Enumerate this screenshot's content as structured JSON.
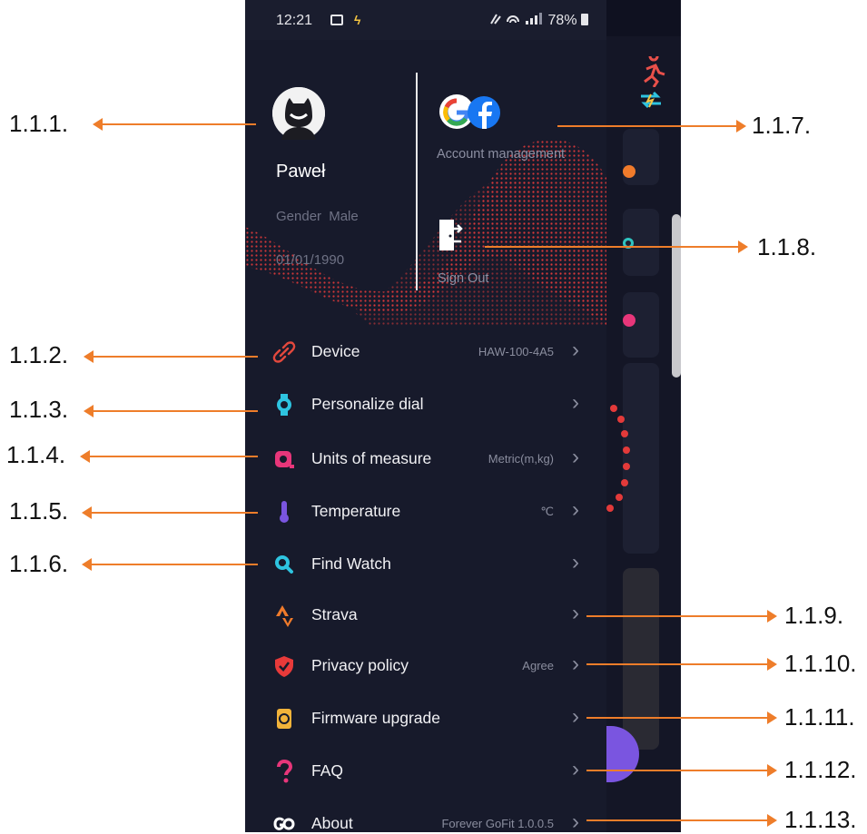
{
  "status_bar": {
    "time": "12:21",
    "battery": "78%"
  },
  "profile": {
    "name": "Paweł",
    "gender_label": "Gender",
    "gender_value": "Male",
    "birth_date": "01/01/1990"
  },
  "account": {
    "management_label": "Account management",
    "sign_out_label": "Sign Out"
  },
  "menu": [
    {
      "label": "Device",
      "value": "HAW-100-4A5",
      "icon": "link-icon",
      "color": "#e2483d"
    },
    {
      "label": "Personalize dial",
      "value": "",
      "icon": "watch-icon",
      "color": "#2ec4e0"
    },
    {
      "label": "Units of measure",
      "value": "Metric(m,kg)",
      "icon": "units-icon",
      "color": "#e8367a"
    },
    {
      "label": "Temperature",
      "value": "℃",
      "icon": "thermometer-icon",
      "color": "#7a55e0"
    },
    {
      "label": "Find Watch",
      "value": "",
      "icon": "search-icon",
      "color": "#2ec4e0"
    },
    {
      "label": "Strava",
      "value": "",
      "icon": "strava-icon",
      "color": "#f07b2b"
    },
    {
      "label": "Privacy policy",
      "value": "Agree",
      "icon": "shield-icon",
      "color": "#e83a3a"
    },
    {
      "label": "Firmware upgrade",
      "value": "",
      "icon": "firmware-icon",
      "color": "#f2b33a"
    },
    {
      "label": "FAQ",
      "value": "",
      "icon": "question-icon",
      "color": "#e8367a"
    },
    {
      "label": "About",
      "value": "Forever GoFit 1.0.0.5",
      "icon": "gofit-icon",
      "color": "#ffffff"
    }
  ],
  "callouts": {
    "c1": "1.1.1.",
    "c2": "1.1.2.",
    "c3": "1.1.3.",
    "c4": "1.1.4.",
    "c5": "1.1.5.",
    "c6": "1.1.6.",
    "c7": "1.1.7.",
    "c8": "1.1.8.",
    "c9": "1.1.9.",
    "c10": "1.1.10.",
    "c11": "1.1.11.",
    "c12": "1.1.12.",
    "c13": "1.1.13."
  },
  "colors": {
    "drawer_bg": "#171a2b",
    "accent_arrow": "#ee7d2a",
    "wave": "#e33a3a"
  }
}
